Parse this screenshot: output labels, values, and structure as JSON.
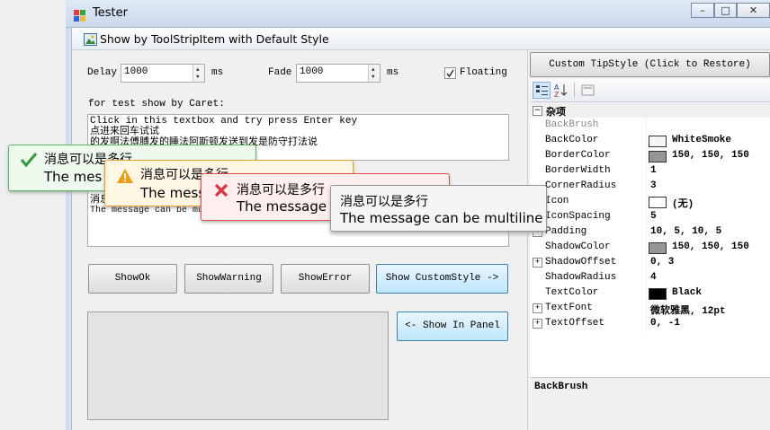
{
  "window": {
    "title": "Tester",
    "controls": [
      "–",
      "□",
      "✕"
    ]
  },
  "toolstrip": {
    "item_label": "Show by ToolStripItem with Default Style"
  },
  "settings": {
    "delay_label": "Delay",
    "delay_value": "1000",
    "delay_unit": "ms",
    "fade_label": "Fade",
    "fade_value": "1000",
    "fade_unit": "ms",
    "floating_label": "Floating",
    "floating_checked": true
  },
  "caret": {
    "label": "for test show by Caret:",
    "lines": [
      "Click in this textbox and try press Enter key",
      "点进来回车试试",
      "的发啊法傅膊发的睡法阿斯顿发送到发是防守打法说"
    ]
  },
  "second_box": {
    "lines": [
      "消息",
      "The message can be mu"
    ]
  },
  "buttons": {
    "show_ok": "ShowOk",
    "show_warning": "ShowWarning",
    "show_error": "ShowError",
    "show_custom": "Show CustomStyle ->",
    "show_in_panel": "<- Show In Panel"
  },
  "right": {
    "custom_button": "Custom TipStyle (Click to Restore)",
    "category": "杂项",
    "properties": [
      {
        "name": "BackBrush",
        "value": "",
        "grey": true
      },
      {
        "name": "BackColor",
        "value": "WhiteSmoke",
        "swatch": "#f5f5f5"
      },
      {
        "name": "BorderColor",
        "value": "150, 150, 150",
        "swatch": "#969696"
      },
      {
        "name": "BorderWidth",
        "value": "1"
      },
      {
        "name": "CornerRadius",
        "value": "3"
      },
      {
        "name": "Icon",
        "value": "(无)",
        "swatch": "#ffffff"
      },
      {
        "name": "IconSpacing",
        "value": "5"
      },
      {
        "name": "Padding",
        "value": "10, 5, 10, 5",
        "expand": true
      },
      {
        "name": "ShadowColor",
        "value": "150, 150, 150",
        "swatch": "#969696"
      },
      {
        "name": "ShadowOffset",
        "value": "0, 3",
        "expand": true
      },
      {
        "name": "ShadowRadius",
        "value": "4"
      },
      {
        "name": "TextColor",
        "value": "Black",
        "swatch": "#000000"
      },
      {
        "name": "TextFont",
        "value": "微软雅黑, 12pt",
        "expand": true
      },
      {
        "name": "TextOffset",
        "value": "0, -1",
        "expand": true
      }
    ],
    "description_title": "BackBrush"
  },
  "tooltips": {
    "ok": {
      "line1": "消息可以是多行",
      "line2": "The mes"
    },
    "warning": {
      "line1": "消息可以是多行",
      "line2": "The mess"
    },
    "error": {
      "line1": "消息可以是多行",
      "line2": "The message"
    },
    "custom": {
      "line1": "消息可以是多行",
      "line2": "The message can be multiline"
    }
  },
  "colors": {
    "ok_border": "#5cb85c",
    "warning_border": "#f0a030",
    "error_border": "#e0484e",
    "custom_border": "#969696"
  }
}
